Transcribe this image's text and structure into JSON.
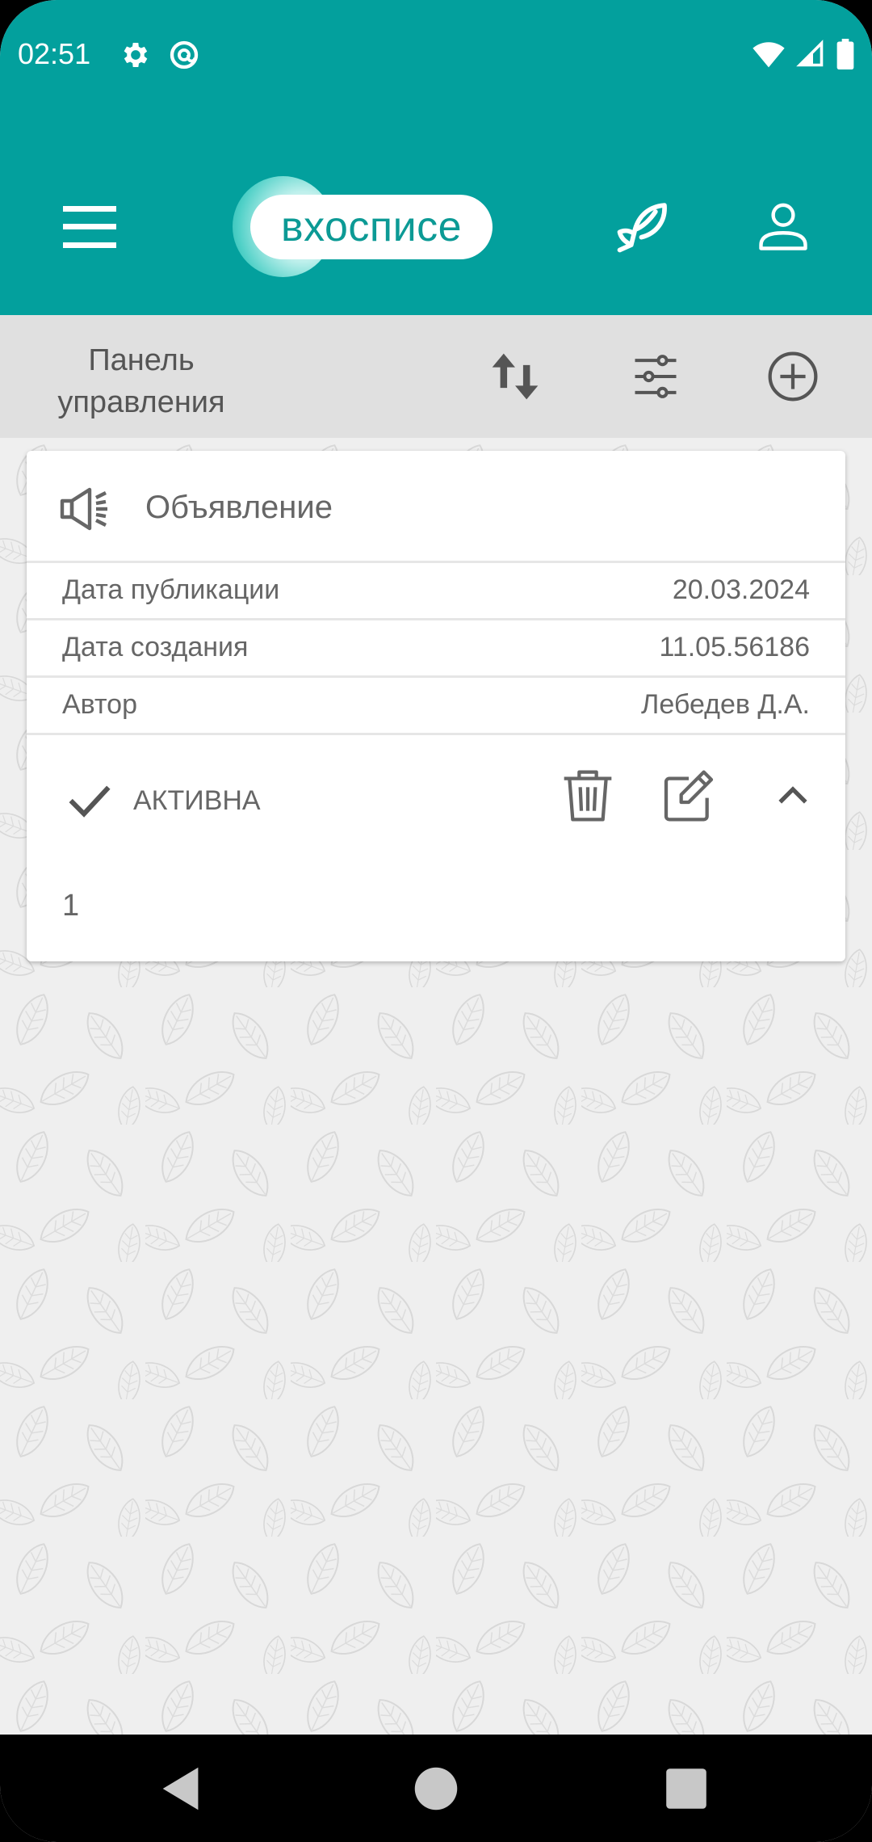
{
  "status_bar": {
    "time": "02:51",
    "left_icons": [
      "gear-icon",
      "at-sign-icon"
    ],
    "right_icons": [
      "wifi-icon",
      "cellular-signal-icon",
      "battery-icon"
    ]
  },
  "app_bar": {
    "logo_text": "вхосписе",
    "icons": [
      "menu-icon",
      "feather-icon",
      "user-icon"
    ],
    "color": "#03a09d"
  },
  "toolbar": {
    "title": "Панель управления",
    "icons": [
      "sort-icon",
      "filter-sliders-icon",
      "add-circle-icon"
    ]
  },
  "card": {
    "icon": "megaphone-icon",
    "title": "Объявление",
    "rows": [
      {
        "label": "Дата публикации",
        "value": "20.03.2024"
      },
      {
        "label": "Дата создания",
        "value": "11.05.56186"
      },
      {
        "label": "Автор",
        "value": "Лебедев Д.А."
      }
    ],
    "status": "АКТИВНА",
    "action_icons": [
      "check-icon",
      "trash-icon",
      "edit-icon",
      "chevron-up-icon"
    ],
    "body": "1"
  },
  "nav_bar": {
    "icons": [
      "back-icon",
      "home-icon",
      "recents-icon"
    ]
  }
}
